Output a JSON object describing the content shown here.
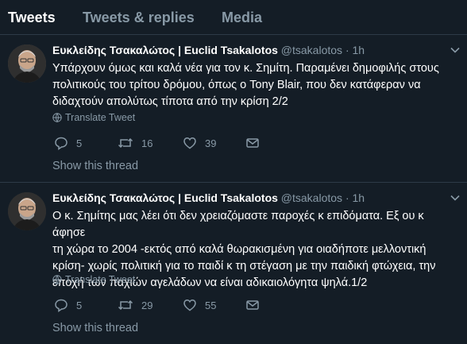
{
  "tabs": [
    {
      "label": "Tweets"
    },
    {
      "label": "Tweets & replies"
    },
    {
      "label": "Media"
    }
  ],
  "tweets": [
    {
      "name": "Ευκλείδης Τσακαλώτος | Euclid Tsakalotos",
      "handle": "@tsakalotos",
      "dot": "·",
      "time": "1h",
      "lines": [
        "Υπάρχουν όμως και καλά νέα για τον κ. Σημίτη. Παραμένει δημοφιλής στους",
        "πολιτικούς του τρίτου δρόμου, όπως ο Tony Blair, που δεν κατάφεραν να",
        "διδαχτούν απολύτως τίποτα από την κρίση 2/2"
      ],
      "translate_label": "Translate Tweet",
      "replies": "5",
      "retweets": "16",
      "likes": "39",
      "show_thread": "Show this thread"
    },
    {
      "name": "Ευκλείδης Τσακαλώτος | Euclid Tsakalotos",
      "handle": "@tsakalotos",
      "dot": "·",
      "time": "1h",
      "lines": [
        "Ο κ. Σημίτης μας λέει ότι δεν χρειαζόμαστε παροχές κ επιδόματα. Εξ ου κ άφησε",
        "τη χώρα το 2004 -εκτός από καλά θωρακισμένη για οιαδήποτε μελλοντική",
        "κρίση- χωρίς πολιτική για το παιδί κ τη στέγαση με την παιδική φτώχεια, την",
        "εποχή των παχιών αγελάδων να είναι αδικαιολόγητα ψηλά.1/2"
      ],
      "translate_label": "Translate Tweet",
      "replies": "5",
      "retweets": "29",
      "likes": "55",
      "show_thread": "Show this thread"
    }
  ],
  "colors": {
    "background": "#141d26",
    "muted": "#8899a6",
    "divider": "#2d3a47"
  }
}
